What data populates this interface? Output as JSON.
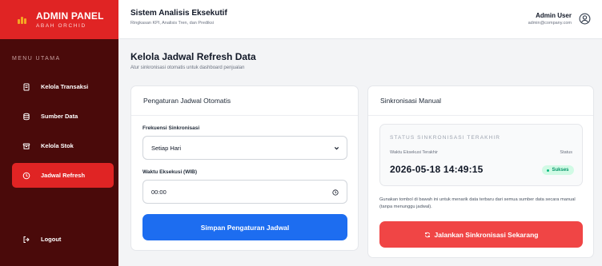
{
  "brand": {
    "title": "ADMIN PANEL",
    "subtitle": "ABAH ORCHID",
    "logo_icon": "bar-chart-icon",
    "logo_color": "#f5a623"
  },
  "sidebar": {
    "menu_header": "MENU UTAMA",
    "items": [
      {
        "label": "Kelola Transaksi",
        "icon": "receipt-icon",
        "active": false
      },
      {
        "label": "Sumber Data",
        "icon": "database-icon",
        "active": false
      },
      {
        "label": "Kelola Stok",
        "icon": "archive-icon",
        "active": false
      },
      {
        "label": "Jadwal Refresh",
        "icon": "clock-icon",
        "active": true
      }
    ],
    "logout_label": "Logout",
    "logout_icon": "logout-icon"
  },
  "header": {
    "title": "Sistem Analisis Eksekutif",
    "subtitle": "Ringkasan KPI, Analisis Tren, dan Prediksi",
    "user_name": "Admin User",
    "user_email": "admin@company.com"
  },
  "page": {
    "title": "Kelola Jadwal Refresh Data",
    "subtitle": "Atur sinkronisasi otomatis untuk dashboard penjualan"
  },
  "schedule_card": {
    "title": "Pengaturan Jadwal Otomatis",
    "frequency_label": "Frekuensi Sinkronisasi",
    "frequency_value": "Setiap Hari",
    "time_label": "Waktu Eksekusi (WIB)",
    "time_value": "00:00",
    "save_label": "Simpan Pengaturan Jadwal"
  },
  "manual_card": {
    "title": "Sinkronisasi Manual",
    "status_header": "STATUS SINKRONISASI TERAKHIR",
    "exec_label": "Waktu Eksekusi Terakhir",
    "status_label": "Status",
    "exec_time": "2026-05-18 14:49:15",
    "status_value": "Sukses",
    "description": "Gunakan tombol di bawah ini untuk menarik data terbaru dari semua sumber data secara manual (tanpa menunggu jadwal).",
    "run_label": "Jalankan Sinkronisasi Sekarang"
  },
  "colors": {
    "sidebar_bg": "#4a0a0a",
    "brand_red": "#e02424",
    "primary_blue": "#1d6df0",
    "danger_red": "#f04545",
    "success_green": "#059669"
  }
}
